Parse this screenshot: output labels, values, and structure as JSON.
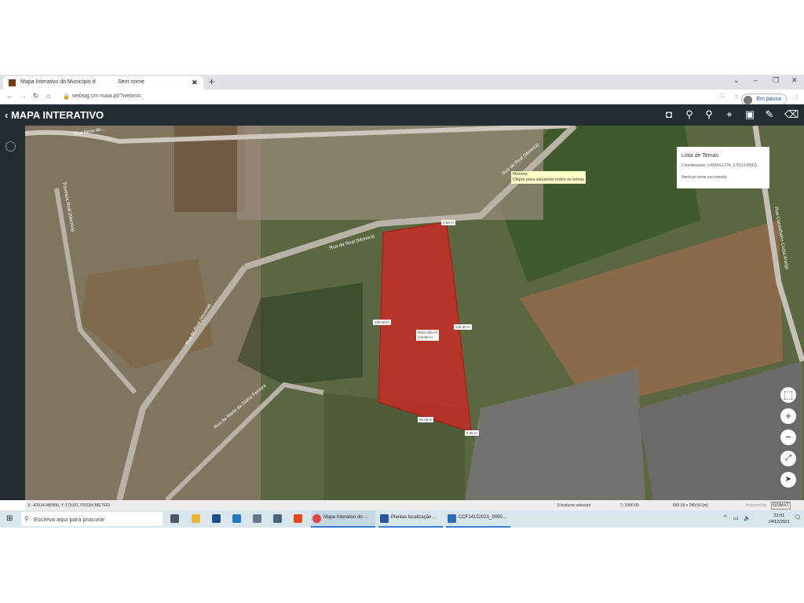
{
  "browser": {
    "tabs": [
      {
        "label": "Mapa Interativo do Município d",
        "active": true
      },
      {
        "label": "Sem nome",
        "active": false
      }
    ],
    "url": "websig.cm-maia.pt/?webmic",
    "profile_label": "Em pausa"
  },
  "app": {
    "title": "MAPA INTERATIVO",
    "tools": [
      "layers-icon",
      "zoom-in-icon",
      "zoom-out-icon",
      "locate-icon",
      "image-icon",
      "pencil-icon",
      "eraser-icon"
    ]
  },
  "map": {
    "street_labels": [
      "Rua Nova de...",
      "Rua da Real (Moreira)",
      "Rua do Real (Moreira)",
      "Rua da Maria da Glória Ferreira",
      "Travessa Real (Moreira)",
      "Rua Conselheiro Costa Araújo",
      "Rua do Real (Moreira)"
    ],
    "tooltip": {
      "line1": "Moreira",
      "line2": "Clique para visualizar todos os temas"
    },
    "popup": {
      "title": "Lista de Temas",
      "coordinates": "Coordenadas: (-42554.1734; 175113.8093)",
      "message": "Nenhum tema encontrado"
    },
    "parcel": {
      "fill": "#d8231e",
      "area": "8021.838 m²",
      "perimeter": "244.86 m",
      "edges": [
        "2.53 m",
        "109.48 m",
        "124.35 m",
        "92.28 m",
        "5.36 m"
      ]
    }
  },
  "status": {
    "coords": "X: -42514.485900, Y: 175151.709334 (METER)",
    "features": "0 features selected",
    "scale": "1: 1000.00",
    "extent": "585.09 x 249.50 (m)",
    "powered": "Powered by",
    "brand": "GSMAT"
  },
  "taskbar": {
    "search_placeholder": "Escreva aqui para procurar",
    "apps": [
      "Mapa Interativo do ...",
      "Plantas localização ...",
      "CCF14122021_0000..."
    ],
    "time": "23:01",
    "date": "14/12/2021"
  }
}
